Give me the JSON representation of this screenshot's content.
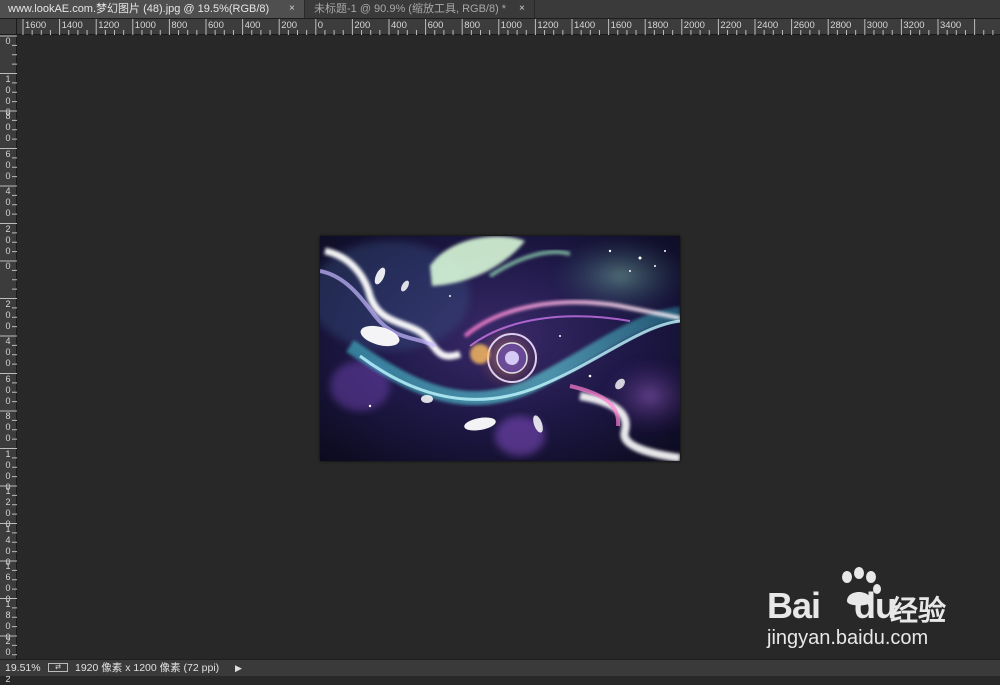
{
  "tabs": [
    {
      "title": "www.lookAE.com.梦幻图片 (48).jpg @ 19.5%(RGB/8)",
      "close": "×",
      "active": true
    },
    {
      "title": "未标题-1 @ 90.9% (缩放工具, RGB/8) *",
      "close": "×",
      "active": false
    }
  ],
  "hruler": {
    "labels": [
      "1600",
      "1400",
      "1200",
      "1000",
      "800",
      "600",
      "400",
      "200",
      "0",
      "200",
      "400",
      "600",
      "800",
      "1000",
      "1200",
      "1400",
      "1600",
      "1800",
      "2000",
      "2200",
      "2400",
      "2600",
      "2800",
      "3000",
      "3200",
      "3400"
    ]
  },
  "vruler": {
    "labels": [
      "0",
      "1000",
      "800",
      "600",
      "400",
      "200",
      "0",
      "200",
      "400",
      "600",
      "800",
      "1000",
      "1200",
      "1400",
      "1600",
      "1800",
      "2000",
      "2"
    ]
  },
  "status": {
    "zoom": "19.51%",
    "doc_info": "1920 像素 x 1200 像素 (72 ppi)",
    "arrow": "▶"
  },
  "watermark": {
    "logo": "Bai",
    "logo_du": "du",
    "jingyan": "经验",
    "url": "jingyan.baidu.com"
  },
  "colors": {
    "workspace": "#282828",
    "ruler": "#3c3c3c",
    "tab_active": "#4f4f4f"
  }
}
